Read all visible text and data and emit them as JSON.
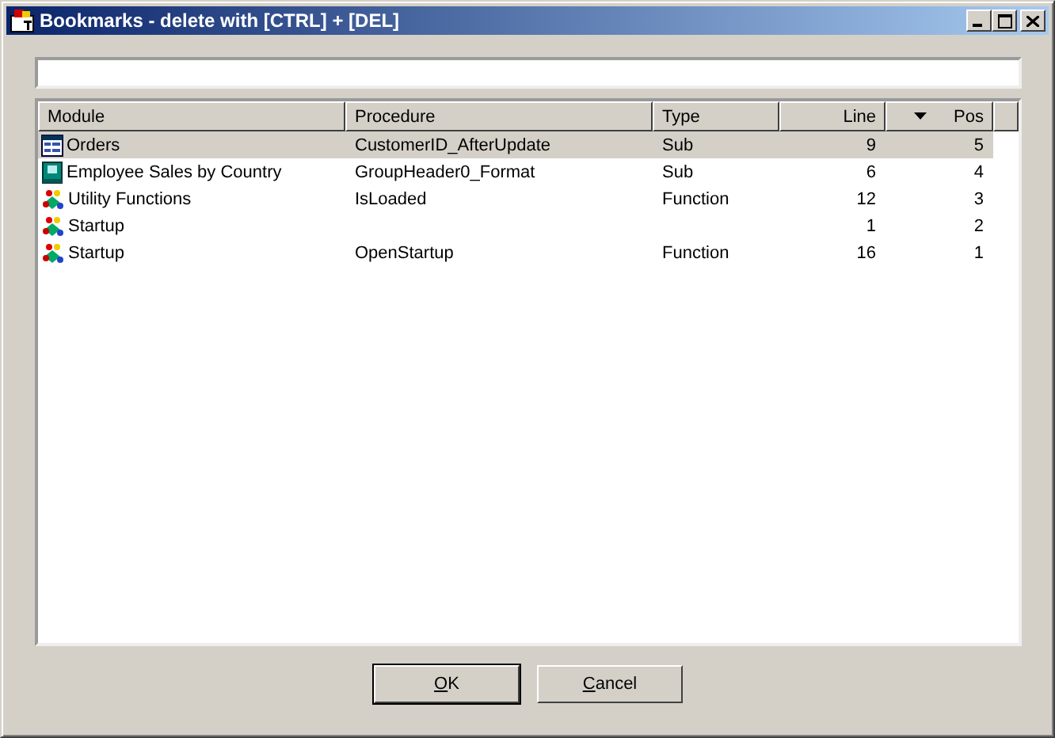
{
  "window": {
    "title": "Bookmarks - delete with [CTRL] + [DEL]"
  },
  "table": {
    "columns": [
      {
        "label": "Module",
        "kind": "text",
        "sorted": false
      },
      {
        "label": "Procedure",
        "kind": "text",
        "sorted": false
      },
      {
        "label": "Type",
        "kind": "text",
        "sorted": false
      },
      {
        "label": "Line",
        "kind": "number",
        "sorted": false
      },
      {
        "label": "Pos",
        "kind": "number",
        "sorted": true
      }
    ],
    "rows": [
      {
        "kind": "form",
        "selected": true,
        "cells": [
          "Orders",
          "CustomerID_AfterUpdate",
          "Sub",
          "9",
          "5"
        ]
      },
      {
        "kind": "report",
        "selected": false,
        "cells": [
          "Employee Sales by Country",
          "GroupHeader0_Format",
          "Sub",
          "6",
          "4"
        ]
      },
      {
        "kind": "module",
        "selected": false,
        "cells": [
          "Utility Functions",
          "IsLoaded",
          "Function",
          "12",
          "3"
        ]
      },
      {
        "kind": "module",
        "selected": false,
        "cells": [
          "Startup",
          "",
          "",
          "1",
          "2"
        ]
      },
      {
        "kind": "module",
        "selected": false,
        "cells": [
          "Startup",
          "OpenStartup",
          "Function",
          "16",
          "1"
        ]
      }
    ]
  },
  "buttons": [
    {
      "label": "OK",
      "default": true
    },
    {
      "label": "Cancel",
      "default": false
    }
  ]
}
